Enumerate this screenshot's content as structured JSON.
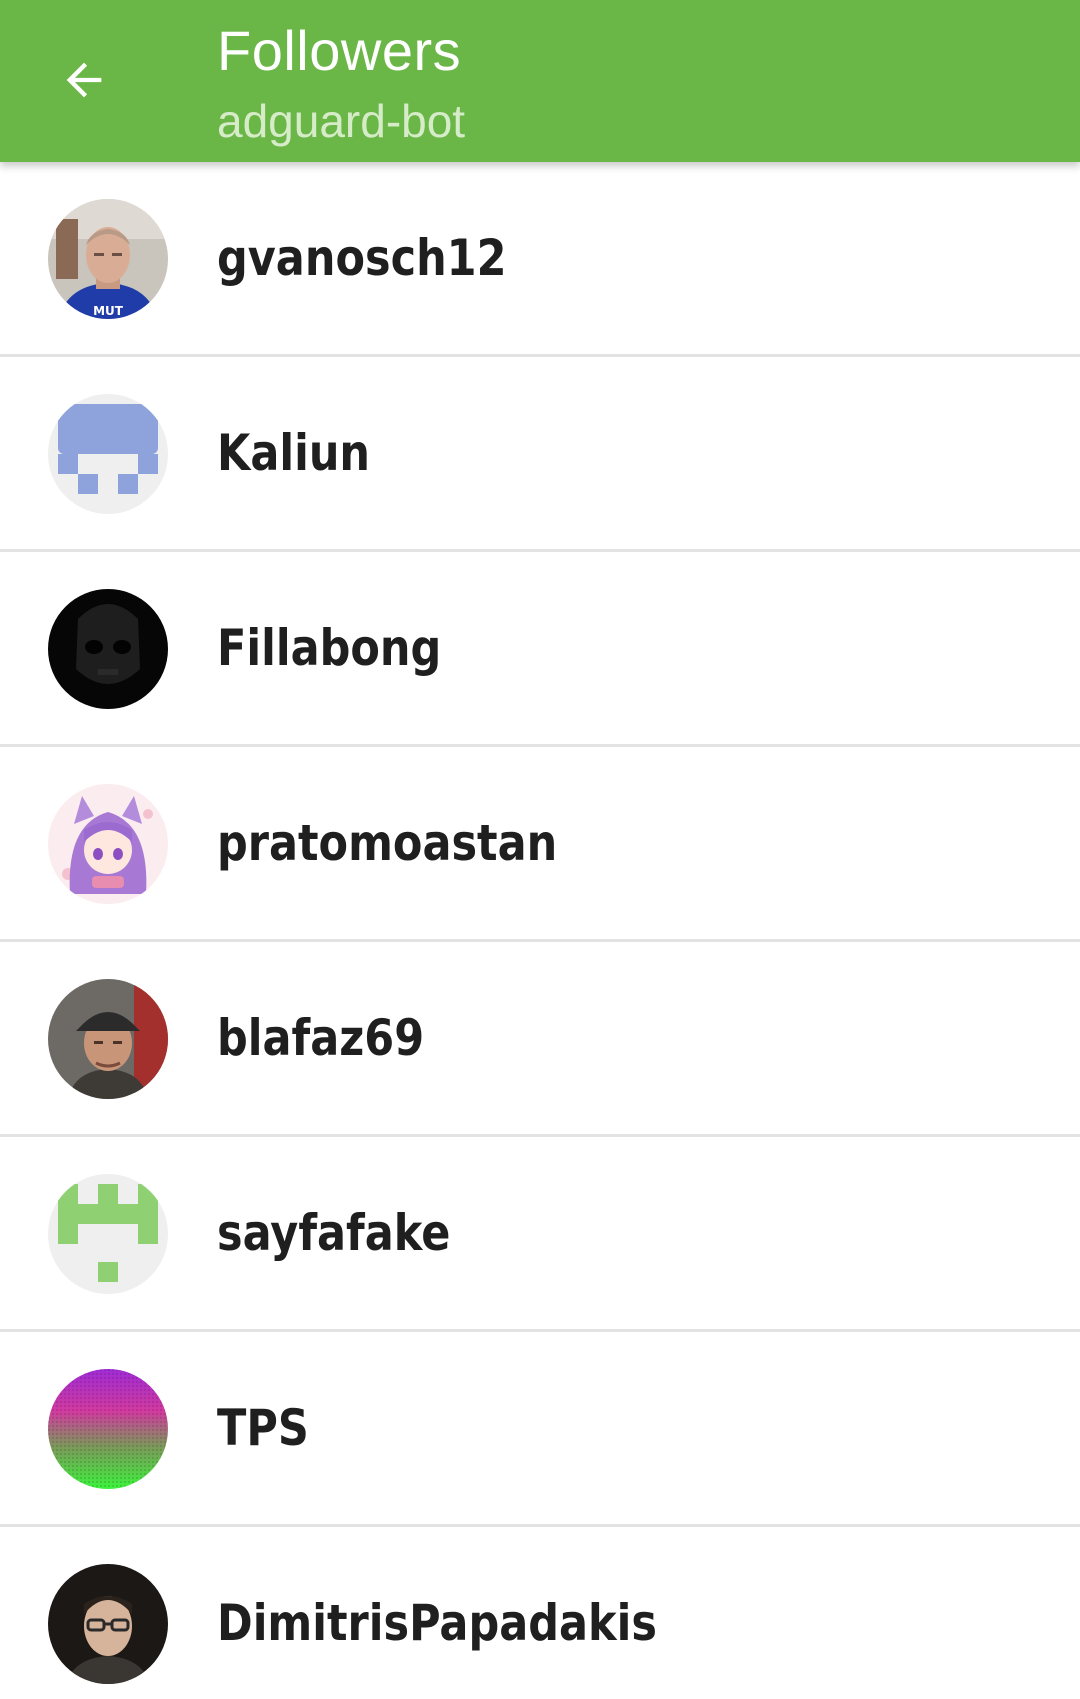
{
  "appbar": {
    "title": "Followers",
    "subtitle": "adguard-bot",
    "back_icon": "arrow-left-icon",
    "background": "#6ab647"
  },
  "followers": [
    {
      "username": "gvanosch12",
      "avatar": "photo"
    },
    {
      "username": "Kaliun",
      "avatar": "identicon-blue"
    },
    {
      "username": "Fillabong",
      "avatar": "dark-skull"
    },
    {
      "username": "pratomoastan",
      "avatar": "anime"
    },
    {
      "username": "blafaz69",
      "avatar": "photo"
    },
    {
      "username": "sayfafake",
      "avatar": "identicon-green"
    },
    {
      "username": "TPS",
      "avatar": "gradient"
    },
    {
      "username": "DimitrisPapadakis",
      "avatar": "photo"
    }
  ]
}
